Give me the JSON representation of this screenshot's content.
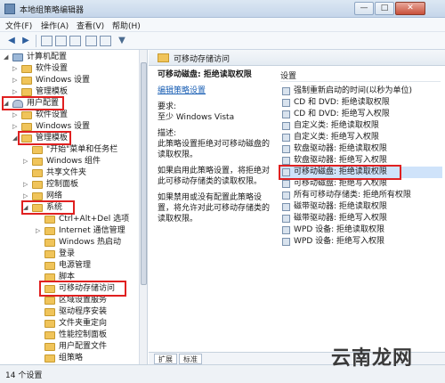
{
  "window": {
    "title": "本地组策略编辑器",
    "minimize": "—",
    "maximize": "□",
    "close": "✕"
  },
  "menu": [
    "文件(F)",
    "操作(A)",
    "查看(V)",
    "帮助(H)"
  ],
  "toolbar_icons": [
    "back-arrow-icon",
    "forward-arrow-icon",
    "up-folder-icon",
    "show-hide-tree-icon",
    "export-list-icon",
    "help-icon",
    "properties-icon",
    "filter-icon"
  ],
  "tree": [
    {
      "label": "计算机配置",
      "arrow": "◢",
      "icon": "comp"
    },
    {
      "label": "软件设置",
      "arrow": "▷",
      "icon": "folder"
    },
    {
      "label": "Windows 设置",
      "arrow": "▷",
      "icon": "folder"
    },
    {
      "label": "管理模板",
      "arrow": "▷",
      "icon": "folder"
    },
    {
      "label": "用户配置",
      "arrow": "◢",
      "icon": "user"
    },
    {
      "label": "软件设置",
      "arrow": "▷",
      "icon": "folder"
    },
    {
      "label": "Windows 设置",
      "arrow": "▷",
      "icon": "folder"
    },
    {
      "label": "管理模板",
      "arrow": "◢",
      "icon": "folder"
    },
    {
      "label": "\"开始\"菜单和任务栏",
      "arrow": "",
      "icon": "folder"
    },
    {
      "label": "Windows 组件",
      "arrow": "▷",
      "icon": "folder"
    },
    {
      "label": "共享文件夹",
      "arrow": "",
      "icon": "folder"
    },
    {
      "label": "控制面板",
      "arrow": "▷",
      "icon": "folder"
    },
    {
      "label": "网络",
      "arrow": "▷",
      "icon": "folder"
    },
    {
      "label": "系统",
      "arrow": "◢",
      "icon": "folder"
    },
    {
      "label": "Ctrl+Alt+Del 选项",
      "arrow": "",
      "icon": "folder"
    },
    {
      "label": "Internet 通信管理",
      "arrow": "▷",
      "icon": "folder"
    },
    {
      "label": "Windows 热启动",
      "arrow": "",
      "icon": "folder"
    },
    {
      "label": "登录",
      "arrow": "",
      "icon": "folder"
    },
    {
      "label": "电源管理",
      "arrow": "",
      "icon": "folder"
    },
    {
      "label": "脚本",
      "arrow": "",
      "icon": "folder"
    },
    {
      "label": "可移动存储访问",
      "arrow": "",
      "icon": "folder"
    },
    {
      "label": "区域设置服务",
      "arrow": "",
      "icon": "folder"
    },
    {
      "label": "驱动程序安装",
      "arrow": "",
      "icon": "folder"
    },
    {
      "label": "文件夹重定向",
      "arrow": "",
      "icon": "folder"
    },
    {
      "label": "性能控制面板",
      "arrow": "",
      "icon": "folder"
    },
    {
      "label": "用户配置文件",
      "arrow": "",
      "icon": "folder"
    },
    {
      "label": "组策略",
      "arrow": "",
      "icon": "folder"
    }
  ],
  "right_header": "可移动存储访问",
  "description": {
    "title": "可移动磁盘: 拒绝读取权限",
    "edit_link": "编辑策略设置",
    "req_label": "要求:",
    "req_value": "至少 Windows Vista",
    "desc_label": "描述:",
    "desc_text": "此策略设置拒绝对可移动磁盘的读取权限。",
    "enabled_text": "如果启用此策略设置，将拒绝对此可移动存储类的读取权限。",
    "disabled_text": "如果禁用或没有配置此策略设置，将允许对此可移动存储类的读取权限。"
  },
  "list_header": "设置",
  "settings": [
    "强制重新启动的时间(以秒为单位)",
    "CD 和 DVD: 拒绝读取权限",
    "CD 和 DVD: 拒绝写入权限",
    "自定义类: 拒绝读取权限",
    "自定义类: 拒绝写入权限",
    "软盘驱动器: 拒绝读取权限",
    "软盘驱动器: 拒绝写入权限",
    "可移动磁盘: 拒绝读取权限",
    "可移动磁盘: 拒绝写入权限",
    "所有可移动存储类: 拒绝所有权限",
    "磁带驱动器: 拒绝读取权限",
    "磁带驱动器: 拒绝写入权限",
    "WPD 设备: 拒绝读取权限",
    "WPD 设备: 拒绝写入权限"
  ],
  "selected_setting_index": 7,
  "tabs": [
    "扩展",
    "标准"
  ],
  "status": "14 个设置",
  "watermark": "云南龙网"
}
